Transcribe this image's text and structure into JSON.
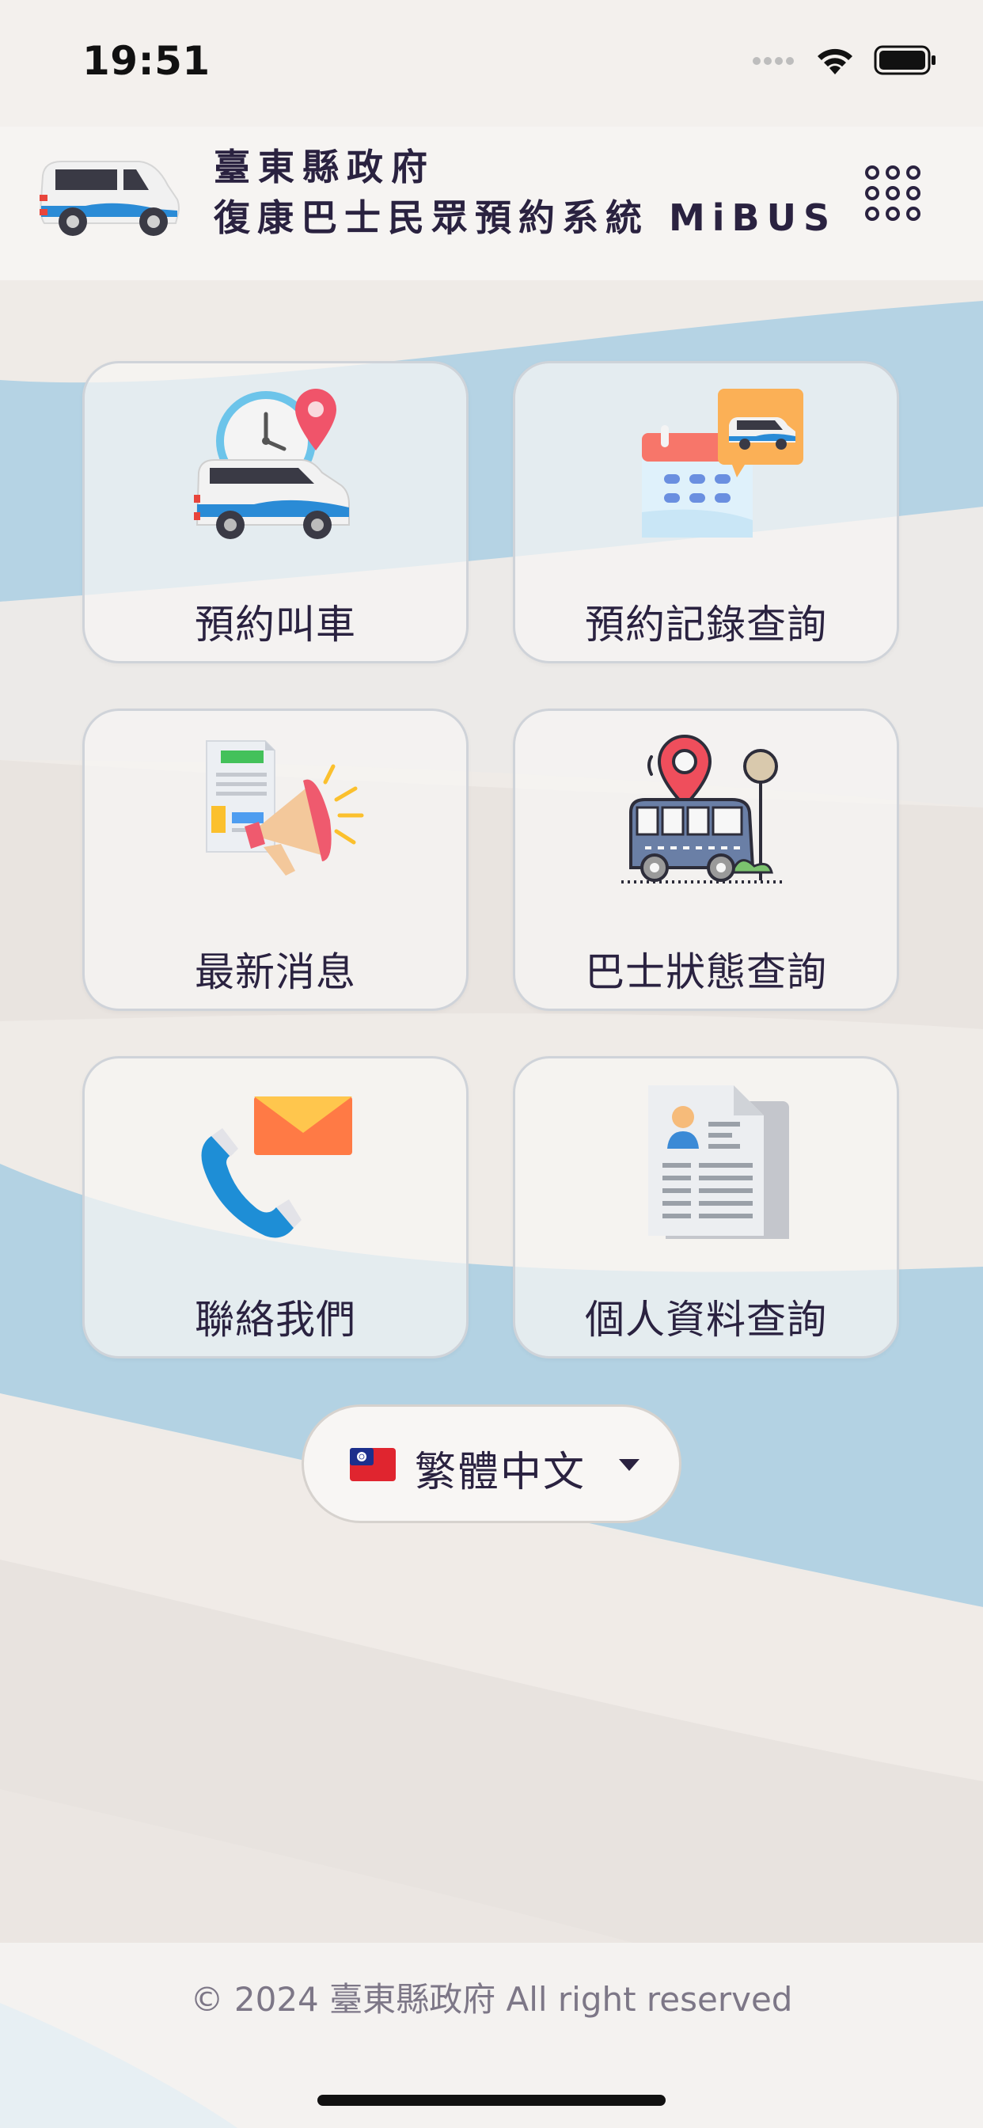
{
  "status_bar": {
    "time": "19:51"
  },
  "header": {
    "title_line1": "臺東縣政府",
    "title_line2": "復康巴士民眾預約系統 MiBUS",
    "logo_icon": "van-icon",
    "menu_icon": "grid-menu-icon"
  },
  "tiles": [
    {
      "label": "預約叫車",
      "icon": "van-clock-pin-icon"
    },
    {
      "label": "預約記錄查詢",
      "icon": "calendar-van-icon"
    },
    {
      "label": "最新消息",
      "icon": "megaphone-news-icon"
    },
    {
      "label": "巴士狀態查詢",
      "icon": "bus-location-icon"
    },
    {
      "label": "聯絡我們",
      "icon": "phone-mail-icon"
    },
    {
      "label": "個人資料查詢",
      "icon": "profile-document-icon"
    }
  ],
  "language": {
    "selected": "繁體中文",
    "flag": "taiwan-flag-icon"
  },
  "footer": {
    "copyright": "© 2024 臺東縣政府 All right reserved"
  },
  "colors": {
    "background": "#f5f3f1",
    "wave_blue": "#b3d2e3",
    "text_dark": "#2a2240",
    "footer_text": "#7d7787"
  }
}
